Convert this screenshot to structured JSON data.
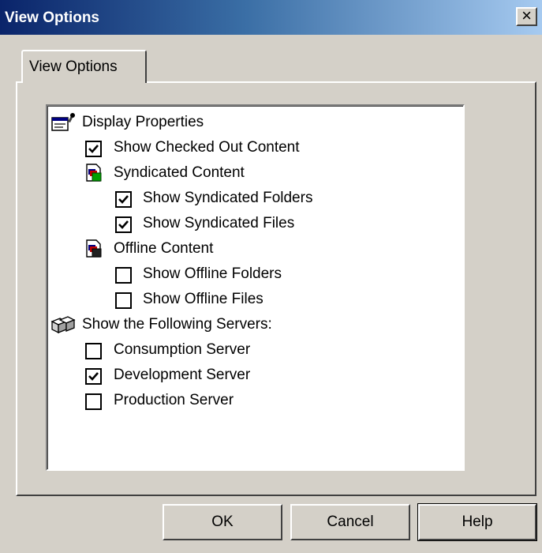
{
  "window": {
    "title": "View Options",
    "close_glyph": "×"
  },
  "tabs": [
    {
      "label": "View Options"
    }
  ],
  "tree": {
    "display_properties": {
      "label": "Display Properties",
      "icon": "properties-icon"
    },
    "show_checked_out": {
      "label": "Show Checked Out Content",
      "checked": true
    },
    "syndicated": {
      "label": "Syndicated Content",
      "icon": "syndicated-content-icon"
    },
    "show_synd_folders": {
      "label": "Show Syndicated Folders",
      "checked": true
    },
    "show_synd_files": {
      "label": "Show Syndicated Files",
      "checked": true
    },
    "offline": {
      "label": "Offline Content",
      "icon": "offline-content-icon"
    },
    "show_offline_folders": {
      "label": "Show Offline Folders",
      "checked": false
    },
    "show_offline_files": {
      "label": "Show Offline Files",
      "checked": false
    },
    "servers": {
      "label": "Show the Following Servers:",
      "icon": "servers-icon"
    },
    "consumption": {
      "label": "Consumption Server",
      "checked": false
    },
    "development": {
      "label": "Development Server",
      "checked": true
    },
    "production": {
      "label": "Production Server",
      "checked": false
    }
  },
  "buttons": {
    "ok": "OK",
    "cancel": "Cancel",
    "help": "Help"
  }
}
